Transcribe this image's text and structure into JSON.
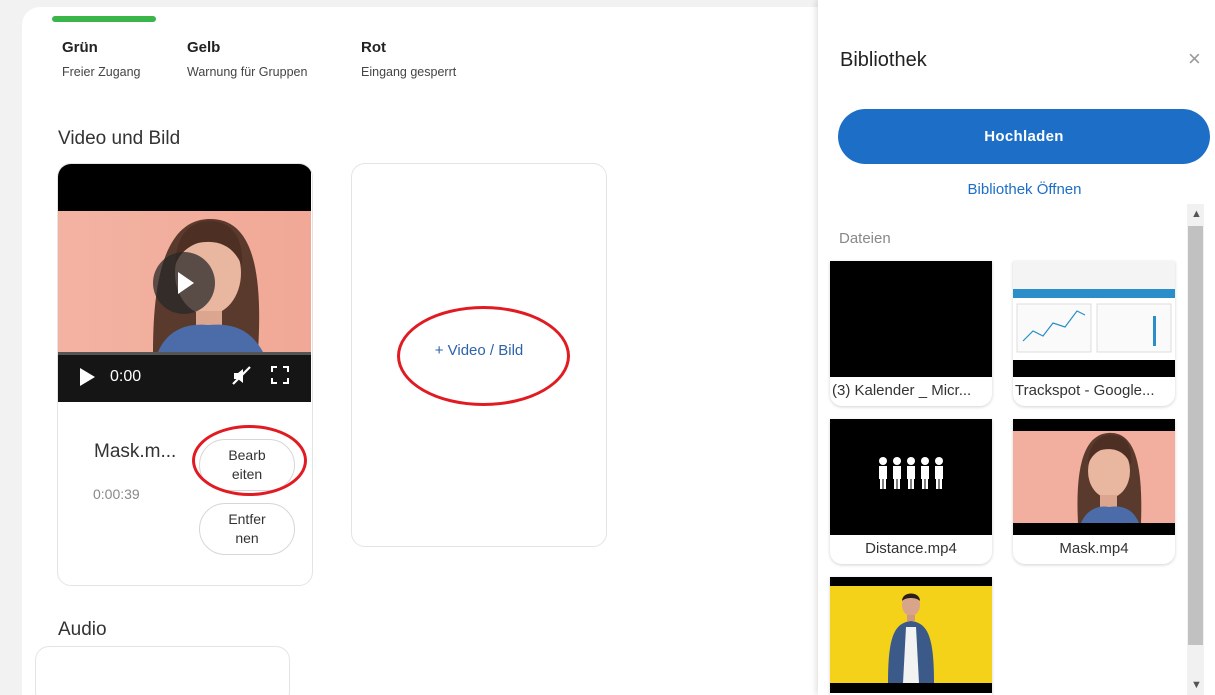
{
  "legend": [
    {
      "title": "Grün",
      "desc": "Freier Zugang"
    },
    {
      "title": "Gelb",
      "desc": "Warnung für Gruppen"
    },
    {
      "title": "Rot",
      "desc": "Eingang gesperrt"
    }
  ],
  "sections": {
    "video_title": "Video und Bild",
    "audio_title": "Audio"
  },
  "media_item": {
    "player_time": "0:00",
    "name": "Mask.m...",
    "duration": "0:00:39",
    "edit_label": "Bearb eiten",
    "remove_label": "Entfer nen"
  },
  "add_media_label": "+ Video / Bild",
  "sidebar": {
    "title": "Bibliothek",
    "close": "×",
    "upload_label": "Hochladen",
    "open_library_label": "Bibliothek Öffnen",
    "files_label": "Dateien",
    "files": [
      {
        "name": "(3) Kalender _ Micr..."
      },
      {
        "name": "Trackspot - Google..."
      },
      {
        "name": "Distance.mp4"
      },
      {
        "name": "Mask.mp4"
      }
    ]
  },
  "colors": {
    "accent_blue": "#1c6ec6",
    "link_blue": "#2c63ab",
    "status_green": "#3ab54a",
    "annotation_red": "#e11b22"
  }
}
